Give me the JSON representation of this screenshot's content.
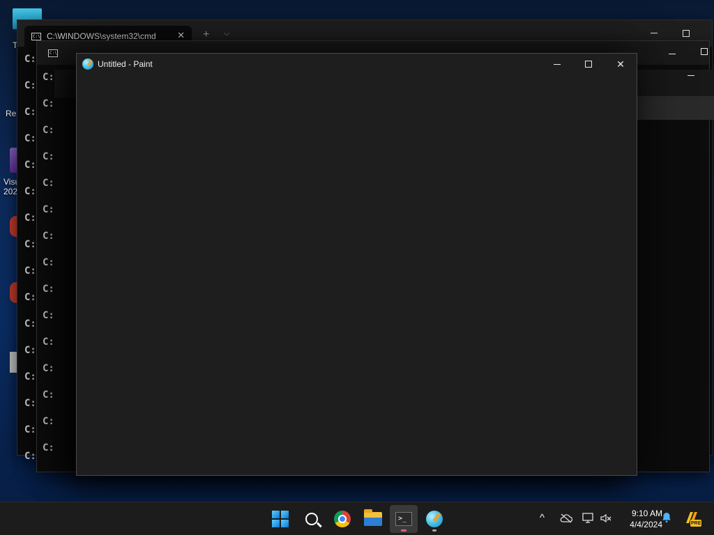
{
  "desktop": {
    "labels": [
      "T",
      "Re",
      "Visu",
      "202"
    ]
  },
  "terminal_back": {
    "tab_title": "C:\\WINDOWS\\system32\\cmd",
    "close_glyph": "✕",
    "new_tab_glyph": "+",
    "dropdown_glyph": "⌵",
    "min_glyph": "—",
    "prompts": [
      "C:",
      "C:",
      "C:",
      "C:",
      "C:",
      "C:",
      "C:",
      "C:",
      "C:",
      "C:",
      "C:",
      "C:",
      "C:",
      "C:",
      "C:",
      "C:"
    ]
  },
  "cmd_mid": {
    "prompts": [
      "C:",
      "C:",
      "C:",
      "C:",
      "C:",
      "C:",
      "C:",
      "C:",
      "C:",
      "C:",
      "C:",
      "C:",
      "C:",
      "C:",
      "C:"
    ]
  },
  "paint": {
    "title": "Untitled - Paint",
    "close_glyph": "✕"
  },
  "taskbar": {
    "apps": [
      "Start",
      "Search",
      "Google Chrome",
      "File Explorer",
      "Terminal",
      "Paint"
    ],
    "tray_chevron": "^",
    "time": "9:10 AM",
    "date": "4/4/2024",
    "badge_text": "PRE"
  },
  "colors": {
    "paint_bg": "#1e1e1e",
    "taskbar_bg": "#1c1c1c",
    "terminal_bg": "#0c0c0c",
    "accent_active": "#e05f8a"
  }
}
